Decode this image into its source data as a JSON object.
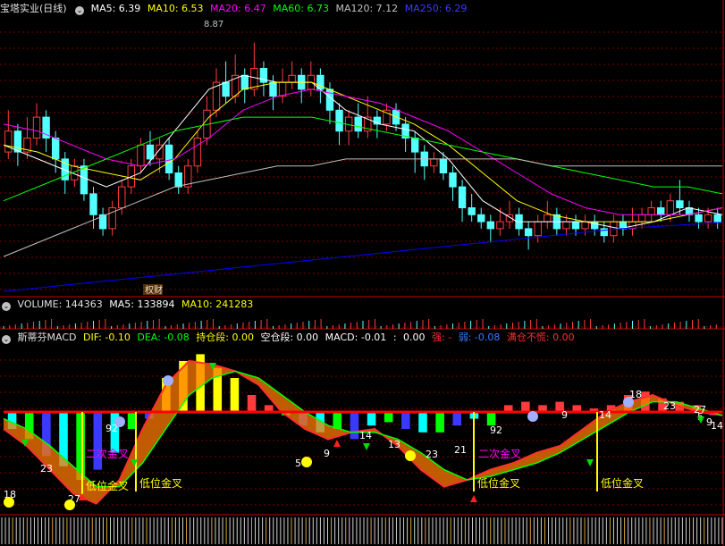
{
  "colors": {
    "bg": "#000000",
    "grid": "#7a0000",
    "border": "#c00000",
    "up": "#ff3b3b",
    "down": "#54ffff",
    "ma5": "#ffffff",
    "ma10": "#ffff00",
    "ma20": "#ff00ff",
    "ma60": "#00ff00",
    "ma120": "#c0c0c0",
    "ma250": "#0000ff",
    "dif": "#ff0000",
    "dea": "#00ff00",
    "zero": "#ff0000",
    "cyan": "#00ffff",
    "yellow": "#ffff00",
    "magenta": "#ff00ff"
  },
  "price_legend": {
    "title": "宝塔实业(日线)",
    "ma5": "MA5: 6.39",
    "ma10": "MA10: 6.53",
    "ma20": "MA20: 6.47",
    "ma60": "MA60: 6.73",
    "ma120": "MA120: 7.12",
    "ma250": "MA250: 6.29"
  },
  "volume_legend": {
    "volume": "VOLUME: 144363",
    "ma5": "MA5: 133894",
    "ma10": "MA10: 241283"
  },
  "macd_legend": {
    "title": "斯蒂芬MACD",
    "dif": "DIF: -0.10",
    "dea": "DEA: -0.08",
    "hold": "持仓段: 0.00",
    "empty": "空仓段: 0.00",
    "macd": "MACD: -0.01",
    "sep": ":",
    "zero": "0.00",
    "strong": "强: -",
    "weak": "弱: -0.08",
    "full_pos": "满仓不慌: 0.00"
  },
  "annotations": {
    "high_label": "8.87",
    "event_marker": "权财"
  },
  "chart_data": {
    "type": "candlestick",
    "high_marked": 8.87,
    "price_ylim": [
      5.25,
      9.25
    ],
    "candles": [
      [
        7.3,
        7.6,
        7.9,
        7.2
      ],
      [
        7.6,
        7.3,
        7.7,
        7.1
      ],
      [
        7.3,
        7.5,
        7.8,
        7.2
      ],
      [
        7.5,
        7.8,
        8.0,
        7.4
      ],
      [
        7.8,
        7.5,
        7.9,
        7.3
      ],
      [
        7.5,
        7.2,
        7.6,
        7.0
      ],
      [
        7.2,
        6.9,
        7.3,
        6.7
      ],
      [
        6.9,
        7.1,
        7.2,
        6.8
      ],
      [
        7.1,
        6.7,
        7.2,
        6.6
      ],
      [
        6.7,
        6.4,
        6.8,
        6.2
      ],
      [
        6.4,
        6.2,
        6.5,
        6.1
      ],
      [
        6.2,
        6.5,
        6.6,
        6.1
      ],
      [
        6.5,
        6.8,
        6.9,
        6.4
      ],
      [
        6.8,
        7.1,
        7.2,
        6.7
      ],
      [
        7.1,
        7.4,
        7.5,
        7.0
      ],
      [
        7.4,
        7.2,
        7.6,
        7.1
      ],
      [
        7.2,
        7.4,
        7.5,
        7.0
      ],
      [
        7.4,
        7.0,
        7.5,
        6.9
      ],
      [
        7.0,
        6.8,
        7.1,
        6.7
      ],
      [
        6.8,
        7.1,
        7.2,
        6.7
      ],
      [
        7.1,
        7.5,
        7.6,
        7.0
      ],
      [
        7.5,
        7.9,
        8.1,
        7.4
      ],
      [
        7.9,
        8.3,
        8.5,
        7.8
      ],
      [
        8.3,
        8.1,
        8.6,
        8.0
      ],
      [
        8.1,
        8.4,
        8.7,
        8.0
      ],
      [
        8.4,
        8.2,
        8.5,
        8.0
      ],
      [
        8.2,
        8.5,
        8.87,
        8.1
      ],
      [
        8.5,
        8.3,
        8.6,
        8.1
      ],
      [
        8.3,
        8.1,
        8.4,
        7.9
      ],
      [
        8.1,
        8.3,
        8.5,
        8.0
      ],
      [
        8.3,
        8.4,
        8.6,
        8.2
      ],
      [
        8.4,
        8.2,
        8.5,
        8.0
      ],
      [
        8.2,
        8.4,
        8.6,
        8.1
      ],
      [
        8.4,
        8.2,
        8.5,
        8.0
      ],
      [
        8.2,
        7.9,
        8.3,
        7.7
      ],
      [
        7.9,
        7.6,
        8.0,
        7.4
      ],
      [
        7.6,
        7.8,
        7.9,
        7.4
      ],
      [
        7.8,
        7.6,
        8.0,
        7.5
      ],
      [
        7.6,
        7.8,
        8.1,
        7.5
      ],
      [
        7.8,
        7.7,
        7.9,
        7.5
      ],
      [
        7.7,
        7.9,
        8.0,
        7.6
      ],
      [
        7.9,
        7.7,
        8.0,
        7.6
      ],
      [
        7.7,
        7.5,
        7.8,
        7.3
      ],
      [
        7.5,
        7.3,
        7.6,
        7.0
      ],
      [
        7.3,
        7.1,
        7.4,
        6.9
      ],
      [
        7.1,
        7.2,
        7.3,
        7.0
      ],
      [
        7.2,
        7.0,
        7.3,
        6.9
      ],
      [
        7.0,
        6.8,
        7.1,
        6.6
      ],
      [
        6.8,
        6.5,
        6.9,
        6.3
      ],
      [
        6.5,
        6.4,
        6.7,
        6.3
      ],
      [
        6.4,
        6.3,
        6.5,
        6.2
      ],
      [
        6.3,
        6.2,
        6.4,
        6.0
      ],
      [
        6.2,
        6.3,
        6.5,
        6.1
      ],
      [
        6.3,
        6.4,
        6.6,
        6.2
      ],
      [
        6.4,
        6.2,
        6.5,
        6.1
      ],
      [
        6.2,
        6.1,
        6.3,
        5.9
      ],
      [
        6.1,
        6.3,
        6.4,
        6.0
      ],
      [
        6.3,
        6.4,
        6.6,
        6.2
      ],
      [
        6.4,
        6.2,
        6.5,
        6.1
      ],
      [
        6.2,
        6.3,
        6.4,
        6.1
      ],
      [
        6.3,
        6.2,
        6.4,
        6.1
      ],
      [
        6.2,
        6.3,
        6.4,
        6.1
      ],
      [
        6.3,
        6.2,
        6.4,
        6.1
      ],
      [
        6.2,
        6.1,
        6.3,
        6.0
      ],
      [
        6.1,
        6.3,
        6.4,
        6.0
      ],
      [
        6.3,
        6.2,
        6.4,
        6.1
      ],
      [
        6.2,
        6.3,
        6.5,
        6.1
      ],
      [
        6.3,
        6.4,
        6.5,
        6.2
      ],
      [
        6.4,
        6.5,
        6.6,
        6.3
      ],
      [
        6.5,
        6.4,
        6.6,
        6.3
      ],
      [
        6.4,
        6.6,
        6.7,
        6.3
      ],
      [
        6.6,
        6.5,
        6.9,
        6.4
      ],
      [
        6.5,
        6.4,
        6.6,
        6.3
      ],
      [
        6.4,
        6.3,
        6.5,
        6.2
      ],
      [
        6.3,
        6.4,
        6.5,
        6.2
      ],
      [
        6.4,
        6.3,
        6.5,
        6.2
      ]
    ],
    "ma_series": [
      {
        "name": "MA5",
        "color": "#ffffff",
        "values": [
          7.4,
          7.2,
          7.0,
          6.8,
          7.0,
          7.6,
          8.2,
          8.4,
          8.3,
          8.3,
          7.9,
          7.7,
          7.6,
          7.2,
          6.6,
          6.3,
          6.3,
          6.3,
          6.2,
          6.3,
          6.5,
          6.4
        ]
      },
      {
        "name": "MA10",
        "color": "#ffff00",
        "values": [
          7.4,
          7.3,
          7.1,
          7.0,
          6.9,
          7.2,
          7.8,
          8.2,
          8.3,
          8.3,
          8.1,
          7.9,
          7.7,
          7.4,
          7.0,
          6.6,
          6.4,
          6.3,
          6.3,
          6.3,
          6.4,
          6.5
        ]
      },
      {
        "name": "MA20",
        "color": "#ff00ff",
        "values": [
          7.7,
          7.6,
          7.4,
          7.2,
          7.1,
          7.2,
          7.5,
          7.9,
          8.1,
          8.2,
          8.1,
          8.0,
          7.8,
          7.6,
          7.3,
          7.0,
          6.7,
          6.5,
          6.4,
          6.4,
          6.4,
          6.5
        ]
      },
      {
        "name": "MA60",
        "color": "#00ff00",
        "values": [
          6.6,
          6.8,
          7.0,
          7.2,
          7.4,
          7.6,
          7.7,
          7.8,
          7.8,
          7.8,
          7.7,
          7.6,
          7.5,
          7.4,
          7.3,
          7.2,
          7.1,
          7.0,
          6.9,
          6.8,
          6.8,
          6.7
        ]
      },
      {
        "name": "MA120",
        "color": "#c0c0c0",
        "values": [
          5.8,
          6.0,
          6.2,
          6.4,
          6.6,
          6.8,
          6.9,
          7.0,
          7.1,
          7.1,
          7.2,
          7.2,
          7.2,
          7.2,
          7.2,
          7.2,
          7.1,
          7.1,
          7.1,
          7.1,
          7.1,
          7.1
        ]
      },
      {
        "name": "MA250",
        "color": "#0000ff",
        "values": [
          5.3,
          5.35,
          5.4,
          5.45,
          5.5,
          5.55,
          5.6,
          5.65,
          5.7,
          5.75,
          5.8,
          5.85,
          5.9,
          5.95,
          6.0,
          6.05,
          6.1,
          6.15,
          6.2,
          6.23,
          6.26,
          6.29
        ]
      }
    ],
    "macd": {
      "ylim": [
        -0.3,
        0.2
      ],
      "dif": [
        -0.05,
        -0.1,
        -0.17,
        -0.24,
        -0.27,
        -0.2,
        -0.05,
        0.08,
        0.15,
        0.14,
        0.12,
        0.08,
        0.0,
        -0.05,
        -0.08,
        -0.06,
        -0.05,
        -0.1,
        -0.17,
        -0.22,
        -0.2,
        -0.17,
        -0.15,
        -0.12,
        -0.1,
        -0.05,
        0.0,
        0.03,
        0.05,
        0.02,
        0.0,
        -0.01
      ],
      "dea": [
        -0.02,
        -0.05,
        -0.1,
        -0.16,
        -0.22,
        -0.22,
        -0.15,
        -0.05,
        0.05,
        0.1,
        0.12,
        0.1,
        0.05,
        0.0,
        -0.04,
        -0.06,
        -0.06,
        -0.08,
        -0.12,
        -0.17,
        -0.2,
        -0.19,
        -0.17,
        -0.15,
        -0.12,
        -0.08,
        -0.04,
        0.0,
        0.03,
        0.03,
        0.01,
        -0.01
      ],
      "bars": [
        -0.05,
        -0.08,
        -0.13,
        -0.16,
        -0.2,
        -0.17,
        -0.12,
        -0.05,
        -0.02,
        0.1,
        0.15,
        0.17,
        0.13,
        0.1,
        0.05,
        0.02,
        -0.01,
        -0.04,
        -0.06,
        -0.05,
        -0.08,
        -0.04,
        -0.03,
        -0.05,
        -0.06,
        -0.06,
        -0.04,
        -0.02,
        -0.04,
        0.02,
        0.03,
        0.02,
        0.03,
        0.02,
        0.01,
        0.02,
        0.05,
        0.06,
        0.04,
        0.03,
        0.02,
        -0.01
      ],
      "labels": [
        "18",
        "27",
        "23",
        "92",
        "5",
        "9",
        "14",
        "13",
        "23",
        "21",
        "92",
        "5",
        "9",
        "14",
        "18",
        "23",
        "27",
        "5",
        "9",
        "14"
      ],
      "signal_text": "低位金叉",
      "second_cross_text": "二次金叉"
    }
  }
}
